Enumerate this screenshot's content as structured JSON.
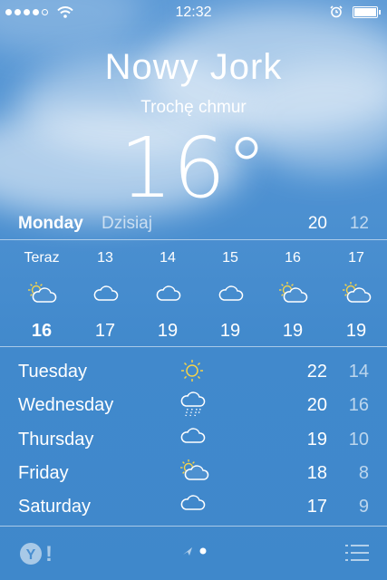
{
  "status_bar": {
    "signal_bars": 4,
    "time": "12:32"
  },
  "location": {
    "city": "Nowy Jork",
    "condition": "Trochę chmur",
    "temperature": "16°"
  },
  "today": {
    "day": "Monday",
    "label": "Dzisiaj",
    "high": "20",
    "low": "12"
  },
  "hourly": [
    {
      "hour": "Teraz",
      "icon": "partly-cloudy-icon",
      "temp": "16"
    },
    {
      "hour": "13",
      "icon": "cloud-icon",
      "temp": "17"
    },
    {
      "hour": "14",
      "icon": "cloud-icon",
      "temp": "19"
    },
    {
      "hour": "15",
      "icon": "cloud-icon",
      "temp": "19"
    },
    {
      "hour": "16",
      "icon": "partly-cloudy-icon",
      "temp": "19"
    },
    {
      "hour": "17",
      "icon": "partly-cloudy-icon",
      "temp": "19"
    }
  ],
  "daily": [
    {
      "day": "Tuesday",
      "icon": "sun-icon",
      "high": "22",
      "low": "14"
    },
    {
      "day": "Wednesday",
      "icon": "rain-cloud-icon",
      "high": "20",
      "low": "16"
    },
    {
      "day": "Thursday",
      "icon": "cloud-icon",
      "high": "19",
      "low": "10"
    },
    {
      "day": "Friday",
      "icon": "partly-cloudy-icon",
      "high": "18",
      "low": "8"
    },
    {
      "day": "Saturday",
      "icon": "cloud-icon",
      "high": "17",
      "low": "9"
    }
  ],
  "footer": {
    "page_count": 2,
    "current_page": 1
  }
}
